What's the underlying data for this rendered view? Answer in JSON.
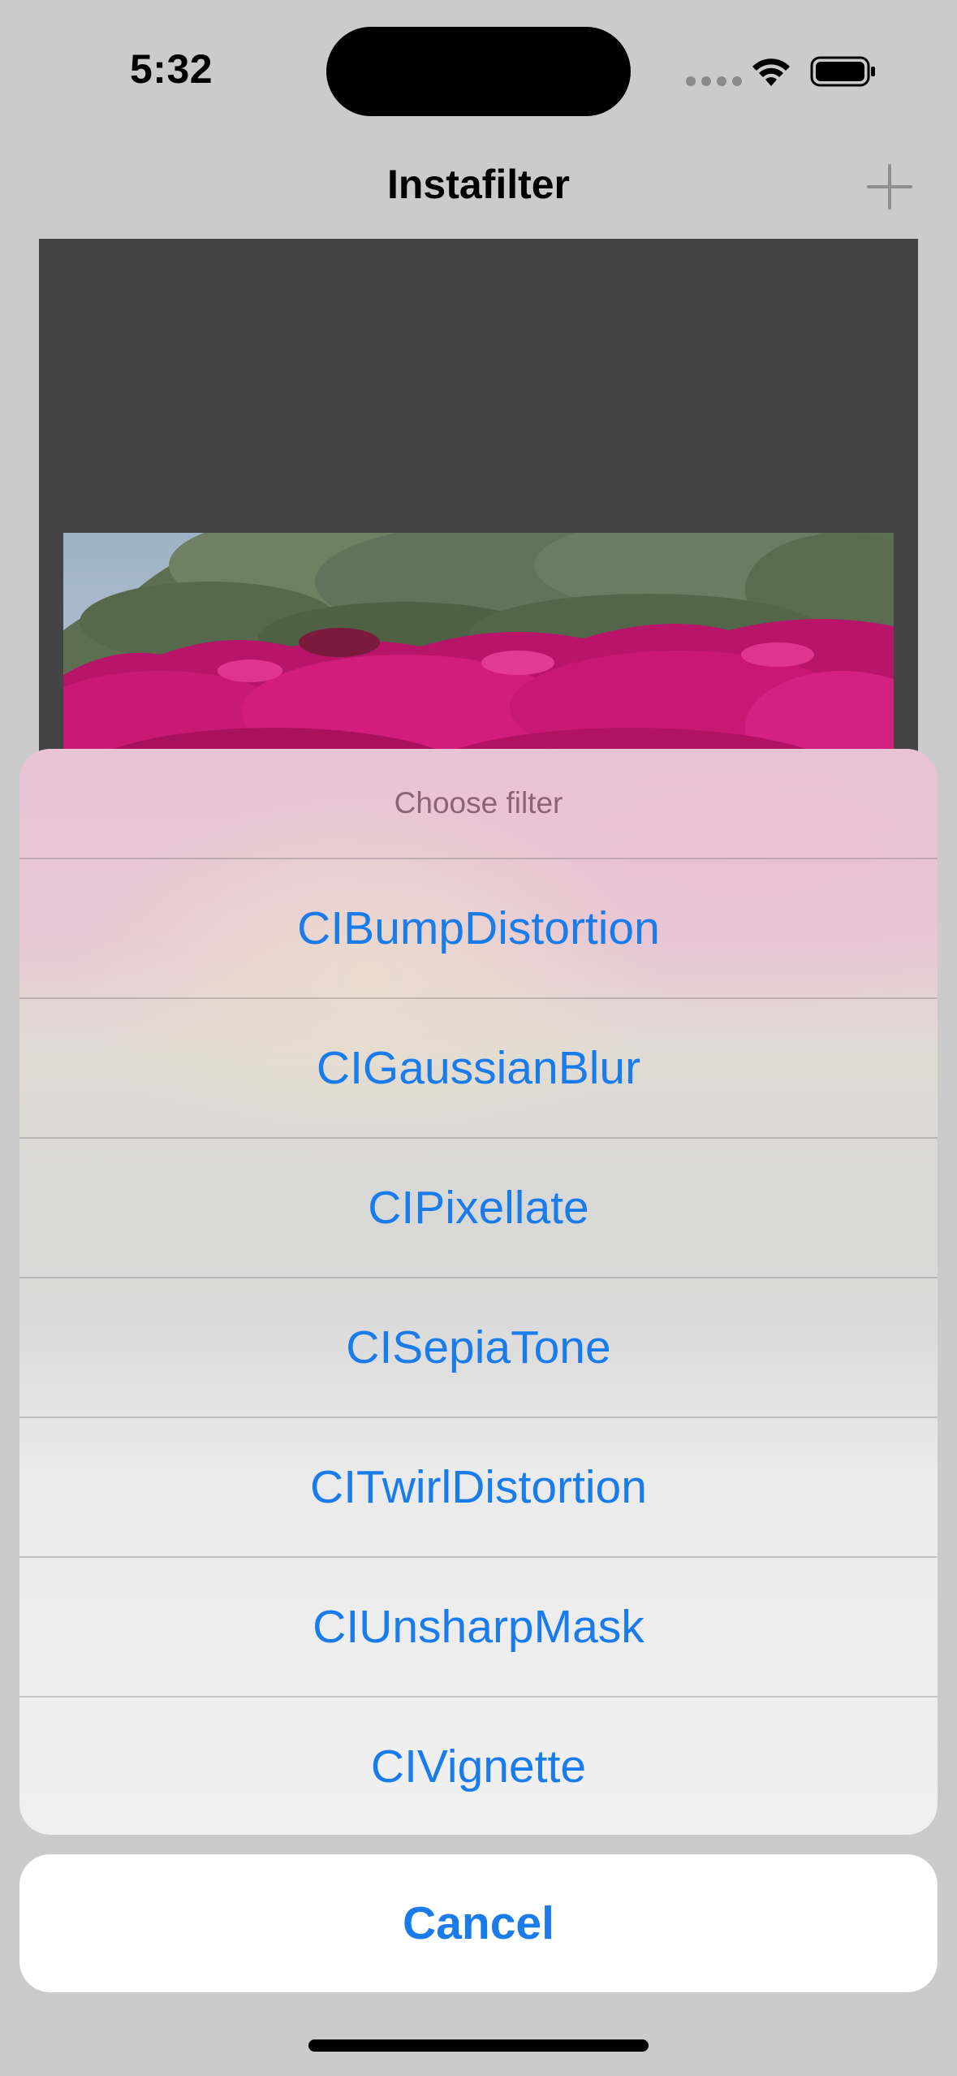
{
  "status_bar": {
    "time": "5:32",
    "icons": [
      "cellular-dots-icon",
      "wifi-icon",
      "battery-icon"
    ]
  },
  "nav": {
    "title": "Instafilter",
    "add_icon": "plus-icon"
  },
  "action_sheet": {
    "title": "Choose filter",
    "options": [
      "CIBumpDistortion",
      "CIGaussianBlur",
      "CIPixellate",
      "CISepiaTone",
      "CITwirlDistortion",
      "CIUnsharpMask",
      "CIVignette"
    ],
    "cancel_label": "Cancel"
  },
  "colors": {
    "accent": "#1a7bea",
    "dim_background": "#cbcbcb",
    "image_panel": "#444444",
    "flowers": "#c0176e"
  }
}
